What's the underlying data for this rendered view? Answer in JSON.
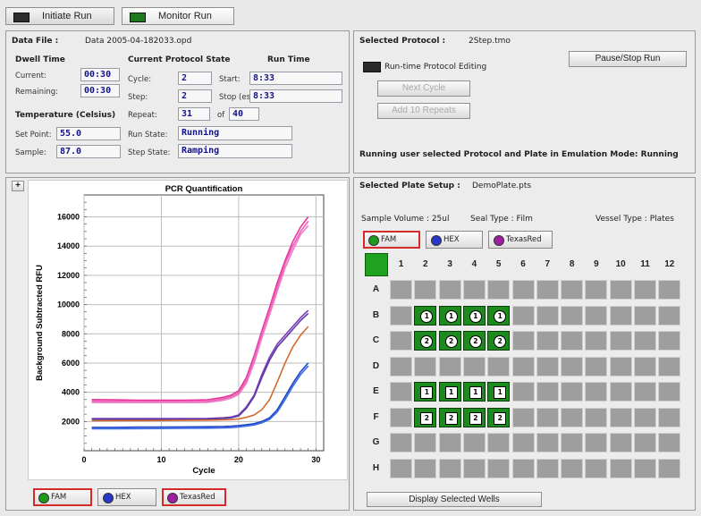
{
  "tabs": [
    {
      "label": "Initiate Run",
      "active": false
    },
    {
      "label": "Monitor Run",
      "active": true
    }
  ],
  "run_panel": {
    "data_file_label": "Data File :",
    "data_file_value": "Data 2005-04-182033.opd",
    "dwell": {
      "title": "Dwell Time",
      "current_label": "Current:",
      "current": "00:30",
      "remaining_label": "Remaining:",
      "remaining": "00:30"
    },
    "protocol_state": {
      "title": "Current Protocol State",
      "cycle_label": "Cycle:",
      "cycle": "2",
      "step_label": "Step:",
      "step": "2",
      "repeat_label": "Repeat:",
      "repeat": "31",
      "of_label": "of",
      "of_value": "40",
      "run_state_label": "Run State:",
      "run_state": "Running",
      "step_state_label": "Step State:",
      "step_state": "Ramping"
    },
    "run_time": {
      "title": "Run Time",
      "start_label": "Start:",
      "start": "8:33",
      "stop_label": "Stop (est):",
      "stop": "8:33"
    },
    "temperature": {
      "title": "Temperature (Celsius)",
      "set_point_label": "Set Point:",
      "set_point": "55.0",
      "sample_label": "Sample:",
      "sample": "87.0"
    }
  },
  "protocol_panel": {
    "title": "Selected Protocol :",
    "file": "2Step.tmo",
    "pause_stop": "Pause/Stop Run",
    "runtime_editing": "Run-time Protocol Editing",
    "next_cycle": "Next Cycle",
    "add_repeats": "Add 10 Repeats",
    "status": "Running user selected Protocol and Plate in Emulation Mode: Running"
  },
  "chart_panel": {
    "collapse": "+",
    "dyes": [
      {
        "label": "FAM",
        "color": "#1e9a1e",
        "selected": true
      },
      {
        "label": "HEX",
        "color": "#2838c8",
        "selected": false
      },
      {
        "label": "TexasRed",
        "color": "#a01ea0",
        "selected": false
      }
    ]
  },
  "chart_data": {
    "type": "line",
    "title": "PCR Quantification",
    "xlabel": "Cycle",
    "ylabel": "Background Subtracted RFU",
    "xlim": [
      0,
      31
    ],
    "ylim": [
      0,
      17500
    ],
    "xticks": [
      "0",
      "10",
      "20",
      "30"
    ],
    "yticks": [
      "2000",
      "4000",
      "6000",
      "8000",
      "10000",
      "12000",
      "14000",
      "16000"
    ],
    "grid": true,
    "x": [
      1,
      4,
      7,
      10,
      13,
      16,
      18,
      19,
      20,
      21,
      22,
      23,
      24,
      25,
      26,
      27,
      28,
      29
    ],
    "series": [
      {
        "color": "#e8349a",
        "values": [
          3500,
          3480,
          3460,
          3450,
          3460,
          3480,
          3650,
          3800,
          4100,
          5000,
          6500,
          8200,
          9800,
          11500,
          13000,
          14300,
          15300,
          16000
        ]
      },
      {
        "color": "#e860b8",
        "values": [
          3400,
          3380,
          3370,
          3360,
          3370,
          3380,
          3550,
          3700,
          3950,
          4800,
          6300,
          8000,
          9600,
          11200,
          12800,
          14000,
          15000,
          15700
        ]
      },
      {
        "color": "#f07ac8",
        "values": [
          3300,
          3300,
          3300,
          3300,
          3300,
          3310,
          3450,
          3600,
          3850,
          4600,
          6000,
          7700,
          9300,
          10900,
          12500,
          13700,
          14800,
          15400
        ]
      },
      {
        "color": "#7b3ab8",
        "values": [
          2200,
          2200,
          2200,
          2200,
          2200,
          2210,
          2250,
          2300,
          2450,
          3000,
          3800,
          5200,
          6400,
          7300,
          7900,
          8500,
          9100,
          9600
        ]
      },
      {
        "color": "#5a3aa8",
        "values": [
          2150,
          2150,
          2150,
          2150,
          2150,
          2160,
          2200,
          2250,
          2380,
          2900,
          3700,
          5000,
          6200,
          7100,
          7700,
          8300,
          8900,
          9400
        ]
      },
      {
        "color": "#d46a2a",
        "values": [
          2050,
          2060,
          2060,
          2070,
          2080,
          2090,
          2110,
          2130,
          2180,
          2280,
          2450,
          2800,
          3500,
          4700,
          6000,
          7100,
          7900,
          8500
        ]
      },
      {
        "color": "#1e46c8",
        "values": [
          1600,
          1600,
          1620,
          1620,
          1630,
          1640,
          1660,
          1680,
          1720,
          1780,
          1850,
          2000,
          2250,
          2800,
          3700,
          4600,
          5400,
          6000
        ]
      },
      {
        "color": "#3c6ae0",
        "values": [
          1500,
          1500,
          1510,
          1520,
          1530,
          1540,
          1560,
          1580,
          1620,
          1680,
          1760,
          1900,
          2150,
          2650,
          3500,
          4400,
          5200,
          5800
        ]
      }
    ]
  },
  "plate_panel": {
    "title": "Selected Plate Setup :",
    "file": "DemoPlate.pts",
    "sample_volume": "Sample Volume : 25ul",
    "seal_type": "Seal Type : Film",
    "vessel_type": "Vessel Type : Plates",
    "dyes": [
      {
        "label": "FAM",
        "color": "#1e9a1e",
        "selected": true
      },
      {
        "label": "HEX",
        "color": "#2838c8",
        "selected": false
      },
      {
        "label": "TexasRed",
        "color": "#a01ea0",
        "selected": false
      }
    ],
    "columns": [
      "1",
      "2",
      "3",
      "4",
      "5",
      "6",
      "7",
      "8",
      "9",
      "10",
      "11",
      "12"
    ],
    "rows": [
      "A",
      "B",
      "C",
      "D",
      "E",
      "F",
      "G",
      "H"
    ],
    "wells": [
      {
        "row": "B",
        "col": 2,
        "label": "1",
        "shape": "round"
      },
      {
        "row": "B",
        "col": 3,
        "label": "1",
        "shape": "round"
      },
      {
        "row": "B",
        "col": 4,
        "label": "1",
        "shape": "round"
      },
      {
        "row": "B",
        "col": 5,
        "label": "1",
        "shape": "round"
      },
      {
        "row": "C",
        "col": 2,
        "label": "2",
        "shape": "round"
      },
      {
        "row": "C",
        "col": 3,
        "label": "2",
        "shape": "round"
      },
      {
        "row": "C",
        "col": 4,
        "label": "2",
        "shape": "round"
      },
      {
        "row": "C",
        "col": 5,
        "label": "2",
        "shape": "round"
      },
      {
        "row": "E",
        "col": 2,
        "label": "1",
        "shape": "square"
      },
      {
        "row": "E",
        "col": 3,
        "label": "1",
        "shape": "square"
      },
      {
        "row": "E",
        "col": 4,
        "label": "1",
        "shape": "square"
      },
      {
        "row": "E",
        "col": 5,
        "label": "1",
        "shape": "square"
      },
      {
        "row": "F",
        "col": 2,
        "label": "2",
        "shape": "square"
      },
      {
        "row": "F",
        "col": 3,
        "label": "2",
        "shape": "square"
      },
      {
        "row": "F",
        "col": 4,
        "label": "2",
        "shape": "square"
      },
      {
        "row": "F",
        "col": 5,
        "label": "2",
        "shape": "square"
      }
    ],
    "display_button": "Display Selected Wells"
  }
}
